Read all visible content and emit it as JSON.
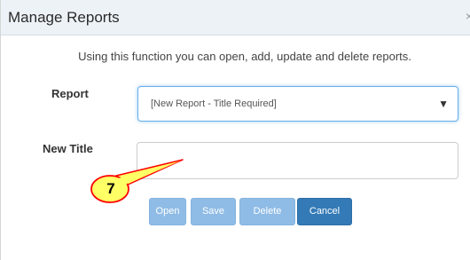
{
  "dialog": {
    "title": "Manage Reports",
    "close_icon": "×",
    "description": "Using this function you can open, add, update and delete reports."
  },
  "form": {
    "report_label": "Report",
    "report_selected": "[New Report - Title Required]",
    "dropdown_arrow": "▼",
    "new_title_label": "New Title",
    "new_title_value": ""
  },
  "buttons": {
    "open": "Open",
    "save": "Save",
    "delete": "Delete",
    "cancel": "Cancel"
  },
  "callout": {
    "number": "7",
    "fill": "#ffff66",
    "border": "#ff0000"
  },
  "colors": {
    "primary": "#337ab7",
    "disabled": "#8fbce6",
    "titlebar": "#edf2f7",
    "focus_border": "#66afe9"
  }
}
